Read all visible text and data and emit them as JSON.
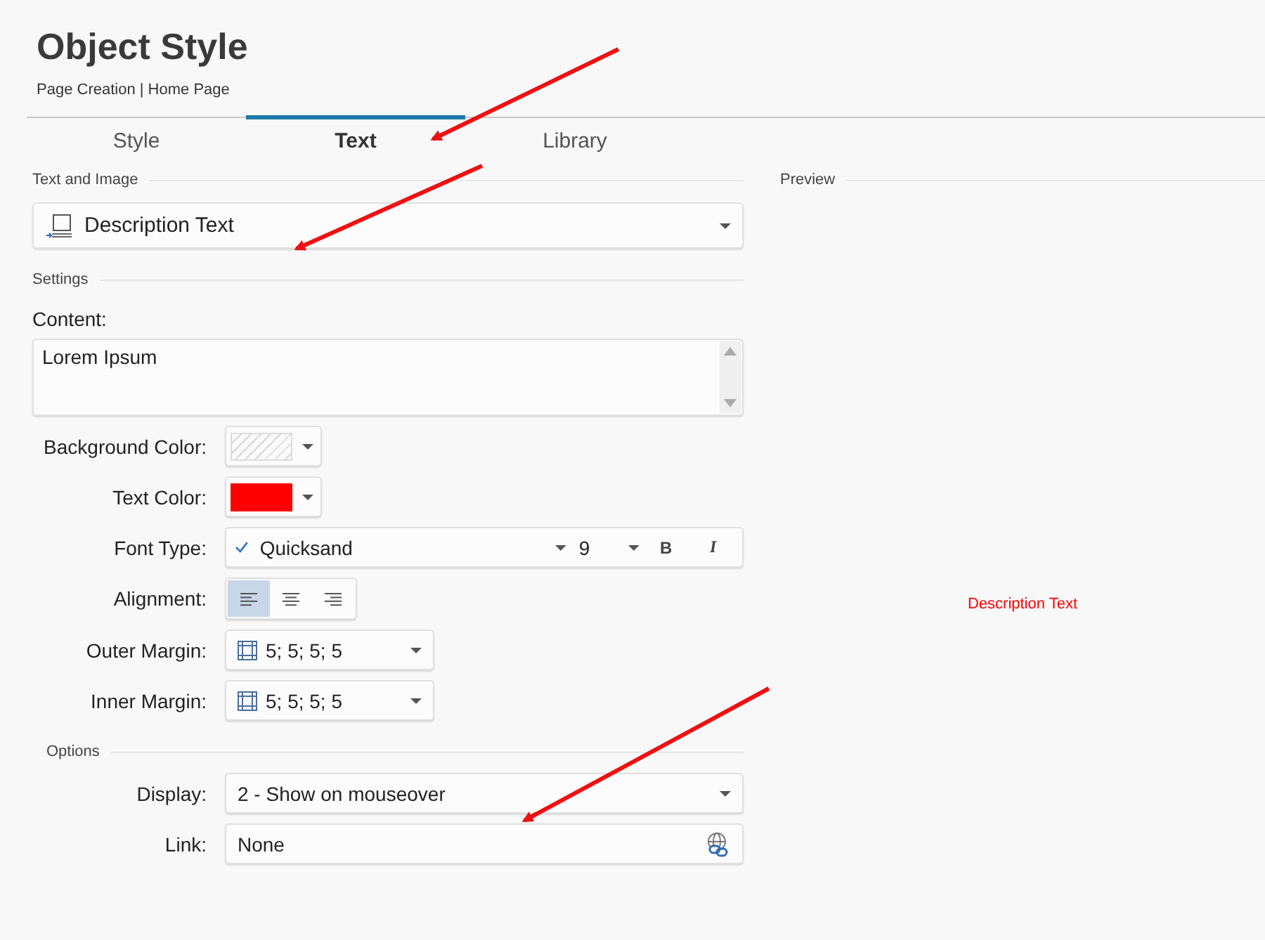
{
  "header": {
    "title": "Object Style",
    "breadcrumb": "Page Creation | Home Page"
  },
  "tabs": [
    {
      "label": "Style",
      "selected": false
    },
    {
      "label": "Text",
      "selected": true
    },
    {
      "label": "Library",
      "selected": false
    }
  ],
  "text_and_image": {
    "heading": "Text and Image",
    "value": "Description Text"
  },
  "settings": {
    "heading": "Settings",
    "content_label": "Content:",
    "content": "Lorem Ipsum",
    "background_color": {
      "label": "Background Color:",
      "kind": "none"
    },
    "text_color": {
      "label": "Text Color:",
      "kind": "solid",
      "color": "#ff0000"
    },
    "font_type": {
      "label": "Font Type:",
      "font": "Quicksand",
      "size": "9",
      "bold": "B",
      "italic": "I"
    },
    "alignment": {
      "label": "Alignment:",
      "options": [
        {
          "kind": "left",
          "selected": true
        },
        {
          "kind": "center",
          "selected": false
        },
        {
          "kind": "right",
          "selected": false
        }
      ]
    },
    "outer_margin": {
      "label": "Outer Margin:",
      "value": "5; 5; 5; 5"
    },
    "inner_margin": {
      "label": "Inner Margin:",
      "value": "5; 5; 5; 5"
    }
  },
  "options": {
    "heading": "Options",
    "display": {
      "label": "Display:",
      "value": "2 - Show on mouseover"
    },
    "link": {
      "label": "Link:",
      "value": "None"
    }
  },
  "preview": {
    "heading": "Preview",
    "text": "Description Text"
  }
}
